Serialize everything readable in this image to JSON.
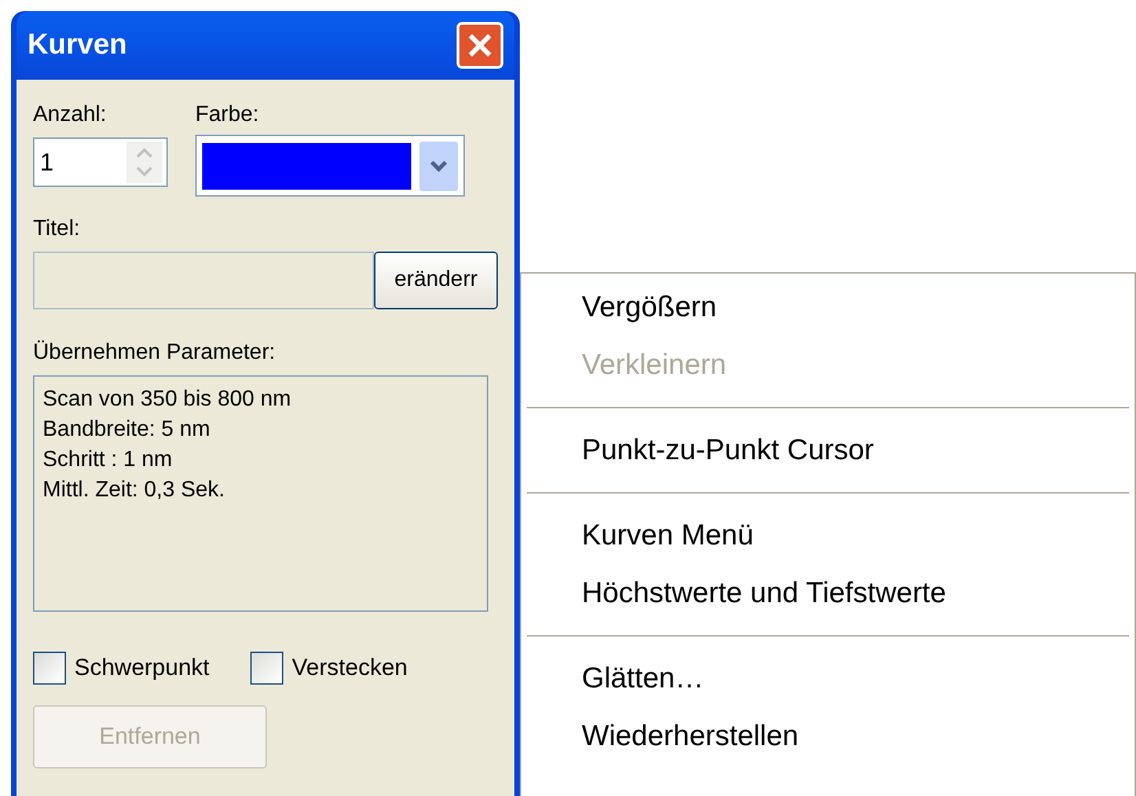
{
  "window": {
    "title": "Kurven"
  },
  "count": {
    "label": "Anzahl:",
    "value": "1"
  },
  "color_picker": {
    "label": "Farbe:",
    "color": "#0000ff"
  },
  "title_field": {
    "label": "Titel:",
    "button": "eränderr"
  },
  "parameters": {
    "label": "Übernehmen Parameter:",
    "lines": [
      "Scan von 350 bis 800 nm",
      "Bandbreite: 5 nm",
      "Schritt : 1 nm",
      "Mittl. Zeit: 0,3 Sek."
    ]
  },
  "checkboxes": [
    {
      "label": "Schwerpunkt",
      "checked": false
    },
    {
      "label": "Verstecken",
      "checked": false
    }
  ],
  "remove_button": {
    "label": "Entfernen",
    "disabled": true
  },
  "context_menu": [
    {
      "kind": "item",
      "label": "Vergößern",
      "disabled": false
    },
    {
      "kind": "item",
      "label": "Verkleinern",
      "disabled": true
    },
    {
      "kind": "separator"
    },
    {
      "kind": "item",
      "label": "Punkt-zu-Punkt Cursor",
      "disabled": false
    },
    {
      "kind": "separator"
    },
    {
      "kind": "item",
      "label": "Kurven Menü",
      "disabled": false
    },
    {
      "kind": "item",
      "label": "Höchstwerte und Tiefstwerte",
      "disabled": false
    },
    {
      "kind": "separator"
    },
    {
      "kind": "item",
      "label": "Glätten…",
      "disabled": false
    },
    {
      "kind": "item",
      "label": "Wiederherstellen",
      "disabled": false
    }
  ]
}
